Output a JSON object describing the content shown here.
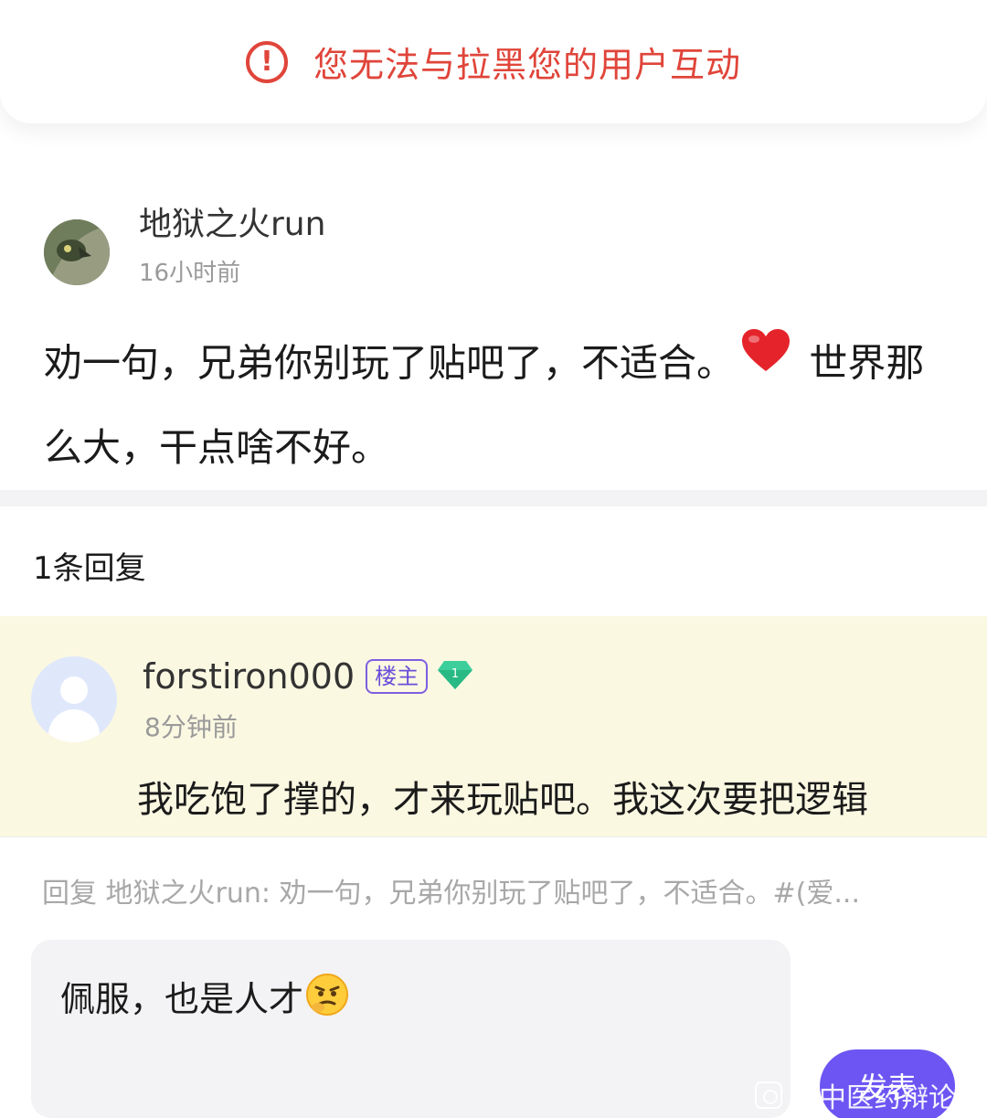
{
  "toast": {
    "icon": "alert-circle-icon",
    "icon_glyph": "!",
    "message": "您无法与拉黑您的用户互动",
    "color": "#e0453a"
  },
  "post": {
    "author": "地狱之火run",
    "time": "16小时前",
    "text_before_emoji": "劝一句，兄弟你别玩了贴吧了，不适合。",
    "emoji": "heart-icon",
    "text_after_emoji": " 世界那么大，干点啥不好。"
  },
  "replies": {
    "count_label": "1条回复"
  },
  "reply": {
    "author": "forstiron000",
    "owner_badge": "楼主",
    "level": "1",
    "time": "8分钟前",
    "text": "我吃饱了撑的，才来玩贴吧。我这次要把逻辑"
  },
  "composer": {
    "quote": "回复 地狱之火run: 劝一句，兄弟你别玩了贴吧了，不适合。#(爱...",
    "input_value": "佩服，也是人才",
    "input_emoji": "thinking-face-icon",
    "send_label": "发表",
    "accent": "#6c55f3"
  },
  "watermark": {
    "text": "中医药辩论吧"
  }
}
